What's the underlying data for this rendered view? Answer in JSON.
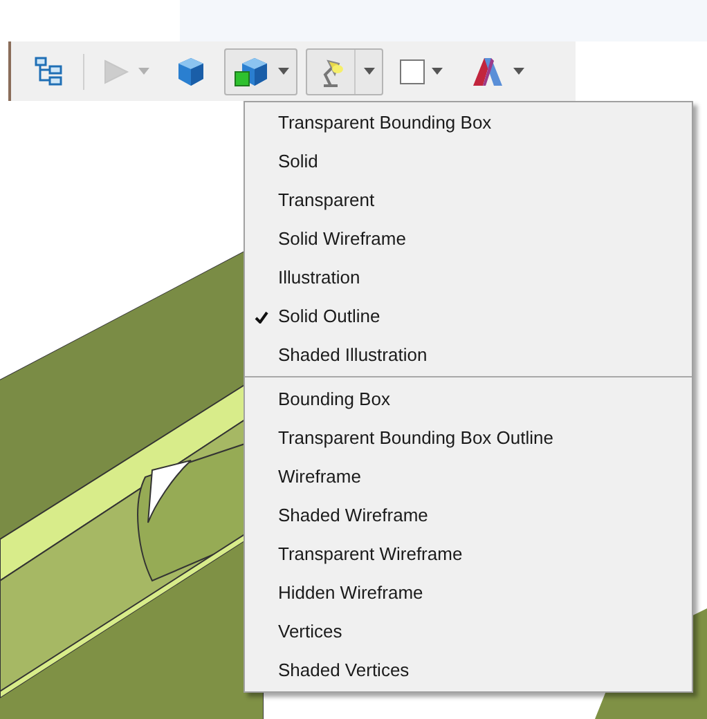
{
  "toolbar": {
    "buttons": [
      {
        "kind": "tree",
        "dropdown": false,
        "pressed": false,
        "disabled": false
      },
      {
        "kind": "play",
        "dropdown": true,
        "pressed": false,
        "disabled": true
      },
      {
        "kind": "cube",
        "dropdown": false,
        "pressed": false,
        "disabled": false
      },
      {
        "kind": "render-mode",
        "dropdown": true,
        "pressed": true,
        "disabled": false
      },
      {
        "kind": "lamp",
        "dropdown": true,
        "pressed": true,
        "disabled": false
      },
      {
        "kind": "background",
        "dropdown": true,
        "pressed": false,
        "disabled": false
      },
      {
        "kind": "material",
        "dropdown": true,
        "pressed": false,
        "disabled": false
      }
    ]
  },
  "menu": {
    "groups": [
      [
        {
          "label": "Transparent Bounding Box",
          "checked": false
        },
        {
          "label": "Solid",
          "checked": false
        },
        {
          "label": "Transparent",
          "checked": false
        },
        {
          "label": "Solid Wireframe",
          "checked": false
        },
        {
          "label": "Illustration",
          "checked": false
        },
        {
          "label": "Solid Outline",
          "checked": true
        },
        {
          "label": "Shaded Illustration",
          "checked": false
        }
      ],
      [
        {
          "label": "Bounding Box",
          "checked": false
        },
        {
          "label": "Transparent Bounding Box Outline",
          "checked": false
        },
        {
          "label": "Wireframe",
          "checked": false
        },
        {
          "label": "Shaded Wireframe",
          "checked": false
        },
        {
          "label": "Transparent Wireframe",
          "checked": false
        },
        {
          "label": "Hidden Wireframe",
          "checked": false
        },
        {
          "label": "Vertices",
          "checked": false
        },
        {
          "label": "Shaded Vertices",
          "checked": false
        }
      ]
    ]
  }
}
